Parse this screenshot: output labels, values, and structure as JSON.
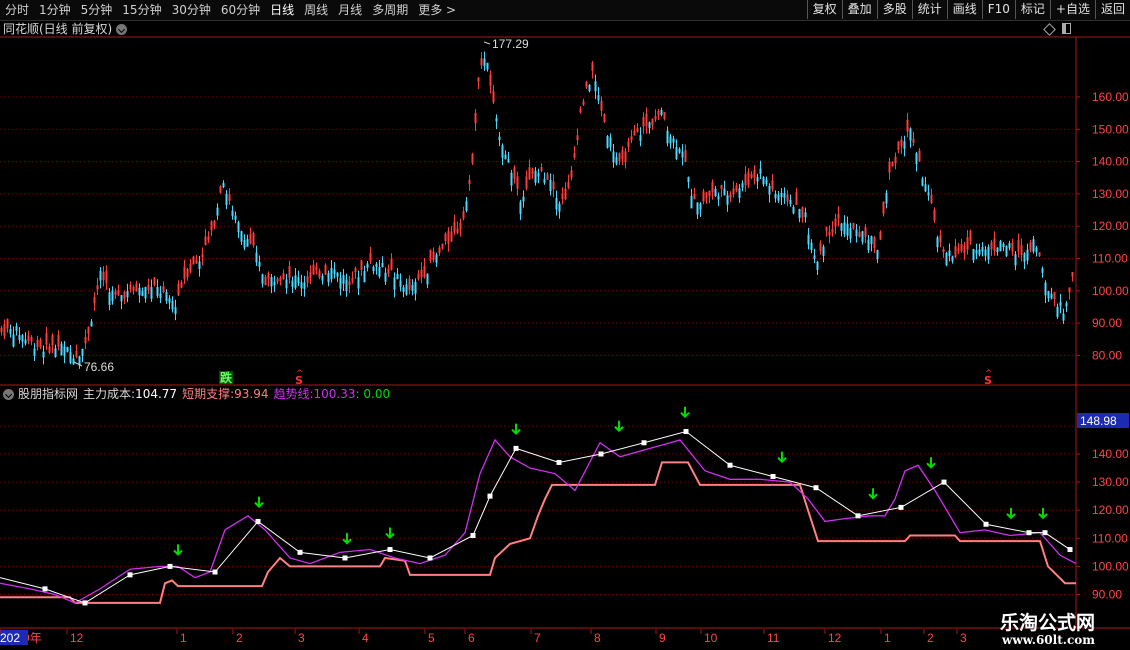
{
  "toolbar": {
    "periods": [
      "分时",
      "1分钟",
      "5分钟",
      "15分钟",
      "30分钟",
      "60分钟",
      "日线",
      "周线",
      "月线",
      "多周期",
      "更多 >"
    ],
    "active": "日线",
    "actions": [
      "复权",
      "叠加",
      "多股",
      "统计",
      "画线",
      "F10",
      "标记",
      "+自选",
      "返回"
    ]
  },
  "chart_title": "同花顺(日线 前复权)",
  "price_axis": [
    "160.00",
    "150.00",
    "140.00",
    "130.00",
    "120.00",
    "110.00",
    "100.00",
    "90.00",
    "80.00"
  ],
  "annotations": {
    "high_label": "177.29",
    "low_label": "76.66",
    "buy_label": "跌",
    "s_label": "S"
  },
  "indicator": {
    "name": "股朋指标网",
    "main_cost_label": "主力成本:",
    "main_cost_value": "104.77",
    "short_support_label": "短期支撑:",
    "short_support_value": "93.94",
    "trend_label": "趋势线:",
    "trend_value": "100.33",
    "extra_value": ": 0.00",
    "axis": [
      "140.00",
      "130.00",
      "120.00",
      "110.00",
      "100.00",
      "90.00"
    ],
    "current_box": "148.98"
  },
  "time_axis": [
    "2019年",
    "12",
    "1",
    "2",
    "3",
    "4",
    "5",
    "6",
    "7",
    "8",
    "9",
    "10",
    "11",
    "12",
    "1",
    "2",
    "3",
    "202"
  ],
  "watermark": {
    "name": "乐淘公式网",
    "url": "www.60lt.com"
  },
  "colors": {
    "up": "#ff3c3c",
    "down": "#4ad8ff",
    "white": "#ffffff",
    "magenta": "#d030f0",
    "salmon": "#ff8080",
    "arrow": "#00dd00",
    "grid": "#7a0000",
    "axis": "#aa1818"
  }
}
